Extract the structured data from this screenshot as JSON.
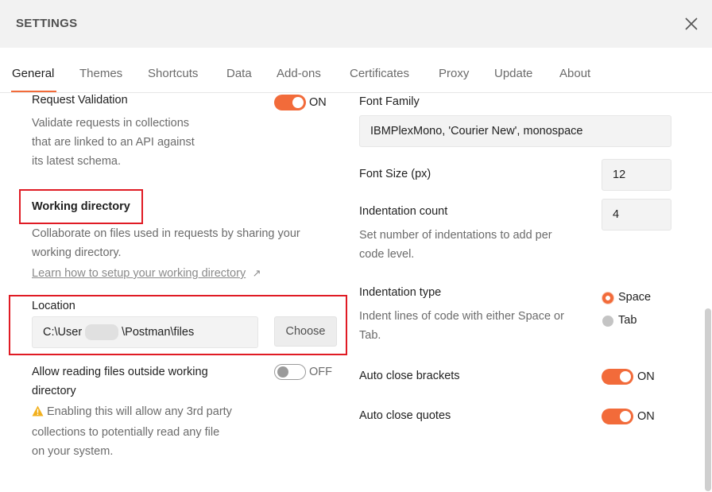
{
  "header": {
    "title": "SETTINGS",
    "close_icon": "close-icon"
  },
  "tabs": [
    {
      "label": "General",
      "active": true
    },
    {
      "label": "Themes"
    },
    {
      "label": "Shortcuts"
    },
    {
      "label": "Data"
    },
    {
      "label": "Add-ons"
    },
    {
      "label": "Certificates"
    },
    {
      "label": "Proxy"
    },
    {
      "label": "Update"
    },
    {
      "label": "About"
    }
  ],
  "left": {
    "request_validation": {
      "label": "Request Validation",
      "toggle_state": "ON",
      "desc_lines": [
        "Validate requests in collections",
        "that are linked to an API against",
        "its latest schema."
      ]
    },
    "working_directory": {
      "heading": "Working directory",
      "desc_lines": [
        "Collaborate on files used in requests by sharing your",
        "working directory."
      ],
      "link": "Learn how to setup your working directory",
      "link_icon": "external-link-icon"
    },
    "location": {
      "label": "Location",
      "path_prefix": "C:\\User",
      "path_suffix": "\\Postman\\files",
      "choose_label": "Choose"
    },
    "allow_outside": {
      "label_lines": [
        "Allow reading files outside working",
        "directory"
      ],
      "toggle_state": "OFF",
      "warning_lines": [
        "Enabling this will allow any 3rd party",
        "collections to potentially read any file",
        "on your system."
      ],
      "warning_icon": "warning-icon"
    }
  },
  "right": {
    "font_family": {
      "label": "Font Family",
      "value": "IBMPlexMono, 'Courier New', monospace"
    },
    "font_size": {
      "label": "Font Size (px)",
      "value": "12"
    },
    "indentation_count": {
      "label": "Indentation count",
      "value": "4",
      "desc_lines": [
        "Set number of indentations to add per",
        "code level."
      ]
    },
    "indentation_type": {
      "label": "Indentation type",
      "desc_lines": [
        "Indent lines of code with either Space or",
        "Tab."
      ],
      "options": [
        {
          "label": "Space",
          "selected": true
        },
        {
          "label": "Tab",
          "selected": false
        }
      ]
    },
    "auto_close_brackets": {
      "label": "Auto close brackets",
      "toggle_state": "ON"
    },
    "auto_close_quotes": {
      "label": "Auto close quotes",
      "toggle_state": "ON"
    }
  },
  "colors": {
    "accent": "#f26b3a",
    "highlight_box": "#e01b24",
    "header_bg": "#f2f2f2"
  }
}
